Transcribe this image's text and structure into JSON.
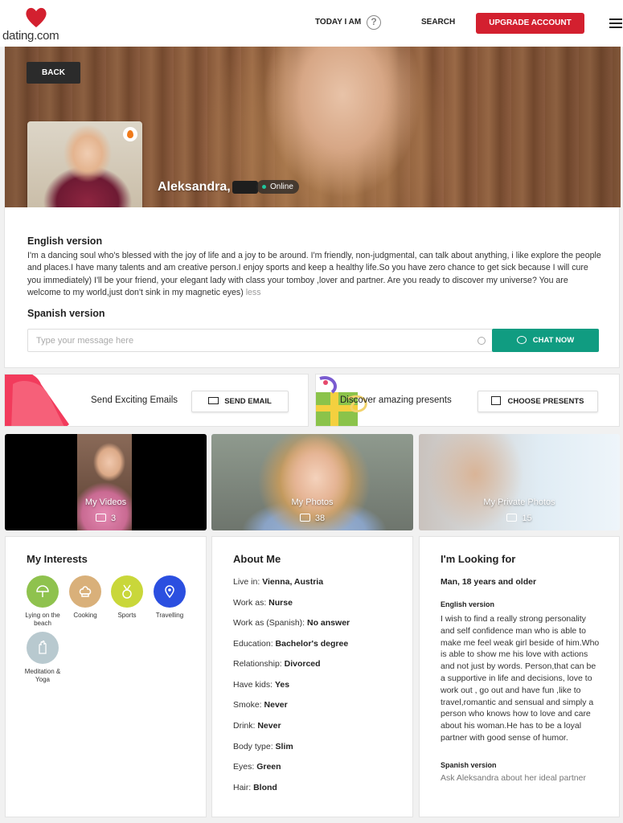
{
  "header": {
    "logo_text": "dating.com",
    "today_label": "TODAY I AM",
    "help_glyph": "?",
    "search_label": "SEARCH",
    "upgrade_label": "UPGRADE ACCOUNT",
    "brand_color": "#d3202f"
  },
  "profile": {
    "back_label": "BACK",
    "name": "Aleksandra,",
    "status": "Online",
    "english_title": "English version",
    "english_text": "I'm a dancing soul who's blessed with the joy of life and a joy to be around. I'm friendly, non-judgmental, can talk about anything, i like explore the people and places.I have many talents and am creative person.I enjoy sports and keep a healthy life.So you have zero chance to get sick because I will cure you immediately) I'll be your friend, your elegant lady with class your tomboy ,lover and partner. Are you ready to discover my universe? You are welcome to my world,just don't sink in my magnetic eyes)",
    "less_label": "less",
    "spanish_title": "Spanish version",
    "message_placeholder": "Type your message here",
    "chat_label": "CHAT NOW",
    "chat_color": "#109c81"
  },
  "promos": {
    "emails_text": "Send Exciting Emails",
    "send_email_label": "SEND EMAIL",
    "presents_text": "Discover amazing presents",
    "choose_presents_label": "CHOOSE PRESENTS"
  },
  "media": {
    "videos": {
      "label": "My Videos",
      "count": "3"
    },
    "photos": {
      "label": "My Photos",
      "count": "38"
    },
    "private": {
      "label": "My Private Photos",
      "count": "15"
    }
  },
  "interests": {
    "title": "My Interests",
    "items": [
      {
        "label": "Lying on the beach",
        "icon": "umbrella-icon",
        "color": "#8fc24e"
      },
      {
        "label": "Cooking",
        "icon": "chef-hat-icon",
        "color": "#d9b07a"
      },
      {
        "label": "Sports",
        "icon": "medal-icon",
        "color": "#c9d73a"
      },
      {
        "label": "Travelling",
        "icon": "map-pin-icon",
        "color": "#2b4fe0"
      },
      {
        "label": "Meditation & Yoga",
        "icon": "lotus-hand-icon",
        "color": "#b8c9cf"
      }
    ]
  },
  "about": {
    "title": "About Me",
    "rows": [
      {
        "label": "Live in:",
        "value": "Vienna, Austria"
      },
      {
        "label": "Work as:",
        "value": "Nurse"
      },
      {
        "label": "Work as (Spanish):",
        "value": "No answer"
      },
      {
        "label": "Education:",
        "value": "Bachelor's degree"
      },
      {
        "label": "Relationship:",
        "value": "Divorced"
      },
      {
        "label": "Have kids:",
        "value": "Yes"
      },
      {
        "label": "Smoke:",
        "value": "Never"
      },
      {
        "label": "Drink:",
        "value": "Never"
      },
      {
        "label": "Body type:",
        "value": "Slim"
      },
      {
        "label": "Eyes:",
        "value": "Green"
      },
      {
        "label": "Hair:",
        "value": "Blond"
      }
    ]
  },
  "looking": {
    "title": "I'm Looking for",
    "summary": "Man, 18 years and older",
    "english_title": "English version",
    "english_text": "I wish to find a really strong personality and self confidence man who is able to make me feel weak girl beside of him.Who is able to show me his love with actions and not just by words. Person,that can be a supportive in life and decisions, love to work out , go out and have fun ,like to travel,romantic and sensual and simply a person who knows how to love and care about his woman.He has to be a loyal partner with good sense of humor.",
    "spanish_title": "Spanish version",
    "spanish_text": "Ask Aleksandra about her ideal partner"
  }
}
